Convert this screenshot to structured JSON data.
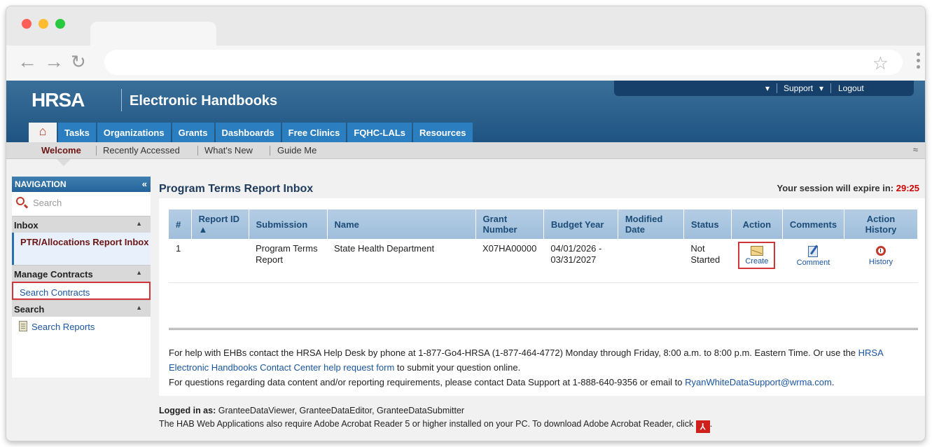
{
  "header": {
    "logo": "HRSA",
    "title": "Electronic Handbooks",
    "utility": {
      "caret": "▾",
      "support": "Support",
      "logout": "Logout"
    },
    "nav_tabs": [
      "Tasks",
      "Organizations",
      "Grants",
      "Dashboards",
      "Free Clinics",
      "FQHC-LALs",
      "Resources"
    ]
  },
  "subnav": {
    "items": [
      "Welcome",
      "Recently Accessed",
      "What's New",
      "Guide Me"
    ],
    "active": "Welcome"
  },
  "sidebar": {
    "title": "NAVIGATION",
    "search_placeholder": "Search",
    "inbox_label": "Inbox",
    "ptr_label": "PTR/Allocations Report Inbox",
    "manage_label": "Manage Contracts",
    "search_contracts": "Search Contracts",
    "search_label": "Search",
    "search_reports": "Search Reports"
  },
  "main": {
    "title": "Program Terms Report Inbox",
    "session_label": "Your session will expire in:",
    "session_time": "29:25",
    "columns": [
      "#",
      "Report ID ▲",
      "Submission",
      "Name",
      "Grant Number",
      "Budget Year",
      "Modified Date",
      "Status",
      "Action",
      "Comments",
      "Action History"
    ],
    "row": {
      "num": "1",
      "report_id": "",
      "submission": "Program Terms Report",
      "name": "State Health Department",
      "grant": "X07HA00000",
      "budget_year": "04/01/2026 - 03/31/2027",
      "modified": "",
      "status": "Not Started",
      "create": "Create",
      "comment": "Comment",
      "history": "History"
    },
    "help1_a": "For help with EHBs contact the HRSA Help Desk by phone at 1-877-Go4-HRSA (1-877-464-4772) Monday through Friday, 8:00 a.m. to 8:00 p.m. Eastern Time. Or use the",
    "help1_link": "HRSA Electronic Handbooks Contact Center help request form",
    "help1_b": "to submit your question online.",
    "help2_a": "For questions regarding data content and/or reporting requirements, please contact Data Support at 1-888-640-9356 or email to",
    "help2_link": "RyanWhiteDataSupport@wrma.com",
    "help2_b": "."
  },
  "footer": {
    "logged_label": "Logged in as:",
    "logged_users": "GranteeDataViewer, GranteeDataEditor, GranteeDataSubmitter",
    "acrobat_text": "The HAB Web Applications also require Adobe Acrobat Reader 5 or higher installed on your PC. To download Adobe Acrobat Reader, click",
    "acrobat_end": "."
  }
}
